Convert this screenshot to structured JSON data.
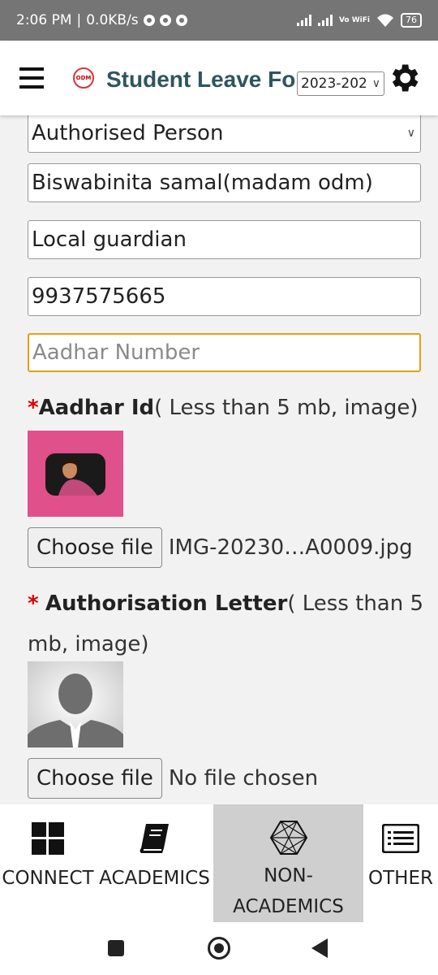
{
  "status_bar": {
    "time": "2:06 PM",
    "speed": "0.0KB/s",
    "network": "Vo WiFi",
    "battery": "76"
  },
  "header": {
    "logo_text": "ODM",
    "title": "Student Leave Form",
    "year_value": "2023-202"
  },
  "form": {
    "authorised_person_select": "Authorised Person",
    "name_value": "Biswabinita samal(madam odm)",
    "relation_value": "Local guardian",
    "phone_value": "9937575665",
    "aadhar_number_placeholder": "Aadhar Number",
    "aadhar_id_label": {
      "star": "*",
      "title": "Aadhar Id",
      "hint": "( Less than 5 mb, image)"
    },
    "aadhar_file": {
      "button": "Choose file",
      "filename": "IMG-20230…A0009.jpg"
    },
    "authorisation_label": {
      "star": "*",
      "title": "Authorisation Letter",
      "hint_line1": "( Less than 5",
      "hint_line2": "mb, image)"
    },
    "authorisation_file": {
      "button": "Choose file",
      "filename": "No file chosen"
    }
  },
  "bottom_nav": {
    "connect": "CONNECT",
    "academics": "ACADEMICS",
    "non_academics_line1": "NON-",
    "non_academics_line2": "ACADEMICS",
    "other": "OTHER"
  },
  "colors": {
    "title": "#2e5560",
    "focus_border": "#e0a019",
    "thumb_bg": "#e0508a",
    "status_bar": "#757575"
  }
}
